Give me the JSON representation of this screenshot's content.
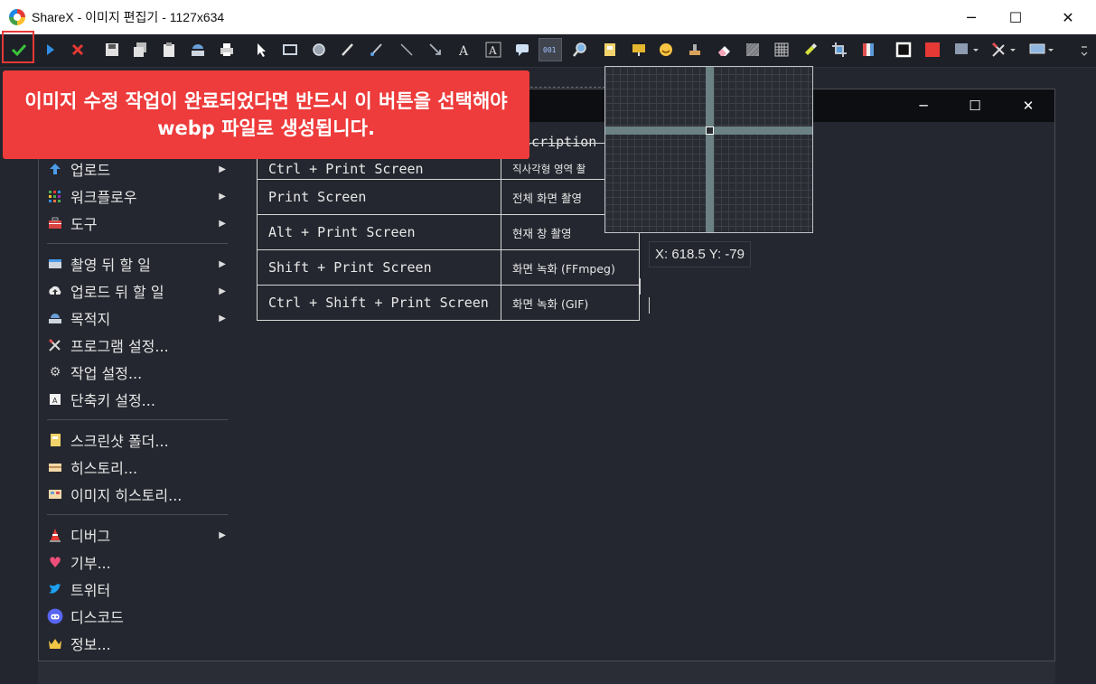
{
  "window": {
    "title": "ShareX - 이미지 편집기 - 1127x634",
    "minimize_glyph": "─",
    "maximize_glyph": "☐",
    "close_glyph": "✕"
  },
  "toolbar": {
    "icons": [
      "confirm-check-icon",
      "play-icon",
      "cancel-x-icon",
      "save-icon",
      "save-as-icon",
      "copy-icon",
      "upload-icon",
      "print-icon",
      "cursor-icon",
      "rectangle-icon",
      "ellipse-icon",
      "freehand-icon",
      "line-icon",
      "arrow-line-icon",
      "arrow-icon",
      "text-icon",
      "text-outline-icon",
      "speech-balloon-icon",
      "step-counter-icon",
      "magnify-icon",
      "sticker-icon",
      "image-icon",
      "emoji-icon",
      "smart-eraser-icon",
      "eraser-icon",
      "blur-icon",
      "pixelate-icon",
      "highlight-icon",
      "crop-icon",
      "cut-out-icon",
      "border-color-icon",
      "fill-color-icon",
      "shadow-dropdown-icon",
      "options-dropdown-icon",
      "screen-dropdown-icon"
    ],
    "colors": {
      "confirm": "#3cc43c",
      "cancel": "#e53935",
      "accent_border": "#e53935"
    }
  },
  "callout": {
    "line1": "이미지 수정 작업이 완료되었다면 반드시 이 버튼을 선택해야",
    "line2": "webp 파일로  생성됩니다."
  },
  "menu": {
    "items": [
      {
        "label": "업로드",
        "icon": "upload-arrow-icon",
        "submenu": true
      },
      {
        "label": "워크플로우",
        "icon": "workflow-grid-icon",
        "submenu": true
      },
      {
        "label": "도구",
        "icon": "toolbox-icon",
        "submenu": true
      },
      {
        "label": "촬영 뒤 할 일",
        "icon": "after-capture-icon",
        "submenu": true
      },
      {
        "label": "업로드 뒤 할 일",
        "icon": "cloud-upload-icon",
        "submenu": true
      },
      {
        "label": "목적지",
        "icon": "destination-icon",
        "submenu": true
      },
      {
        "label": "프로그램 설정...",
        "icon": "wrench-icon",
        "submenu": false
      },
      {
        "label": "작업 설정...",
        "icon": "gear-icon",
        "submenu": false
      },
      {
        "label": "단축키 설정...",
        "icon": "keyboard-icon",
        "submenu": false
      },
      {
        "label": "스크린샷 폴더...",
        "icon": "folder-icon",
        "submenu": false
      },
      {
        "label": "히스토리...",
        "icon": "history-icon",
        "submenu": false
      },
      {
        "label": "이미지 히스토리...",
        "icon": "image-history-icon",
        "submenu": false
      },
      {
        "label": "디버그",
        "icon": "traffic-cone-icon",
        "submenu": true
      },
      {
        "label": "기부...",
        "icon": "heart-icon",
        "submenu": false
      },
      {
        "label": "트위터",
        "icon": "twitter-icon",
        "submenu": false
      },
      {
        "label": "디스코드",
        "icon": "discord-icon",
        "submenu": false
      },
      {
        "label": "정보...",
        "icon": "crown-icon",
        "submenu": false
      }
    ],
    "submenu_glyph": "▶"
  },
  "hotkeys": {
    "desc_header": "escription",
    "rows": [
      {
        "key": "Ctrl + Print Screen",
        "desc": "직사각형 영역 촬"
      },
      {
        "key": "Print Screen",
        "desc": "전체 화면 촬영"
      },
      {
        "key": "Alt + Print Screen",
        "desc": "현재 창 촬영"
      },
      {
        "key": "Shift + Print Screen",
        "desc": "화면 녹화 (FFmpeg)"
      },
      {
        "key": "Ctrl + Shift + Print Screen",
        "desc": "화면 녹화 (GIF)"
      }
    ]
  },
  "magnifier": {
    "coords": "X: 618.5 Y: -79"
  }
}
